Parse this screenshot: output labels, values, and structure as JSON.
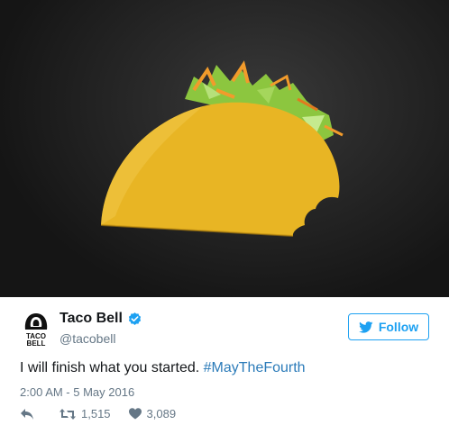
{
  "media": {
    "description_icon": "taco-image",
    "colors": {
      "shell": "#e8b524",
      "background": "#1f1f1f",
      "lettuce": "#8cc63f",
      "cheese": "#f29b2b"
    }
  },
  "user": {
    "name": "Taco Bell",
    "handle": "@tacobell",
    "avatar_text_line1": "TACO",
    "avatar_text_line2": "BELL",
    "verified_icon": "verified-badge-icon"
  },
  "follow": {
    "label": "Follow",
    "icon": "twitter-bird-icon",
    "color": "#1da1f2"
  },
  "tweet": {
    "text": "I will finish what you started. ",
    "hashtag": "#MayTheFourth",
    "timestamp": "2:00 AM - 5 May 2016"
  },
  "actions": {
    "reply_icon": "reply-icon",
    "retweet_icon": "retweet-icon",
    "retweets": "1,515",
    "like_icon": "heart-icon",
    "likes": "3,089"
  }
}
